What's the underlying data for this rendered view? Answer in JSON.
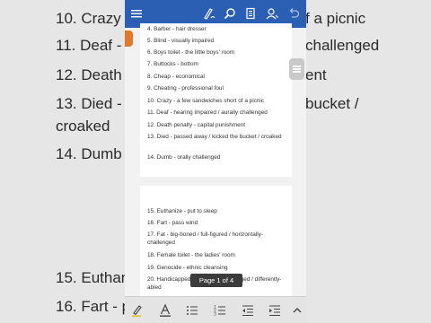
{
  "background": {
    "left_lines": [
      "10. Crazy -",
      "11. Deaf -",
      "12. Death",
      "13. Died -",
      "croaked",
      "14. Dumb",
      "15. Euthan",
      "16. Fart - p"
    ],
    "right_lines": [
      "f a picnic",
      "challenged",
      "ent",
      "bucket /"
    ]
  },
  "toolbar": {
    "icons": [
      "menu-icon",
      "draw-icon",
      "search-icon",
      "reader-icon",
      "share-person-icon",
      "undo-icon"
    ]
  },
  "page1": {
    "items": [
      "4. Barber - hair dresser",
      "5. Blind - visually impaired",
      "6. Boys toilet - the little boys' room",
      "7. Buttocks - bottom",
      "8. Cheap - economical",
      "9. Cheating - professional foul",
      "10. Crazy - a few sandwiches short of a picnic",
      "11. Deaf - hearing impaired / aurally challenged",
      "12. Death penalty - capital punishment",
      "13. Died - passed away / kicked the bucket / croaked",
      "14. Dumb - orally challenged"
    ]
  },
  "page2": {
    "items": [
      "15. Euthanize - put to sleep",
      "16. Fart - pass wind",
      "17. Fat - big-boned / full-figured / horizontally-challenged",
      "18. Female toilet - the ladies' room",
      "19. Genocide - ethnic cleansing",
      "20. Handicapped - physically challenged / differently-abled"
    ]
  },
  "page_indicator": "Page 1 of 4",
  "bottom_toolbar": {
    "icons": [
      "highlighter-icon",
      "text-format-icon",
      "bullet-list-icon",
      "numbered-list-icon",
      "decrease-indent-icon",
      "increase-indent-icon",
      "chevron-up-icon"
    ]
  },
  "colors": {
    "toolbar": "#2b5fb4",
    "accent_tab": "#e07a2a",
    "page": "#ffffff"
  }
}
